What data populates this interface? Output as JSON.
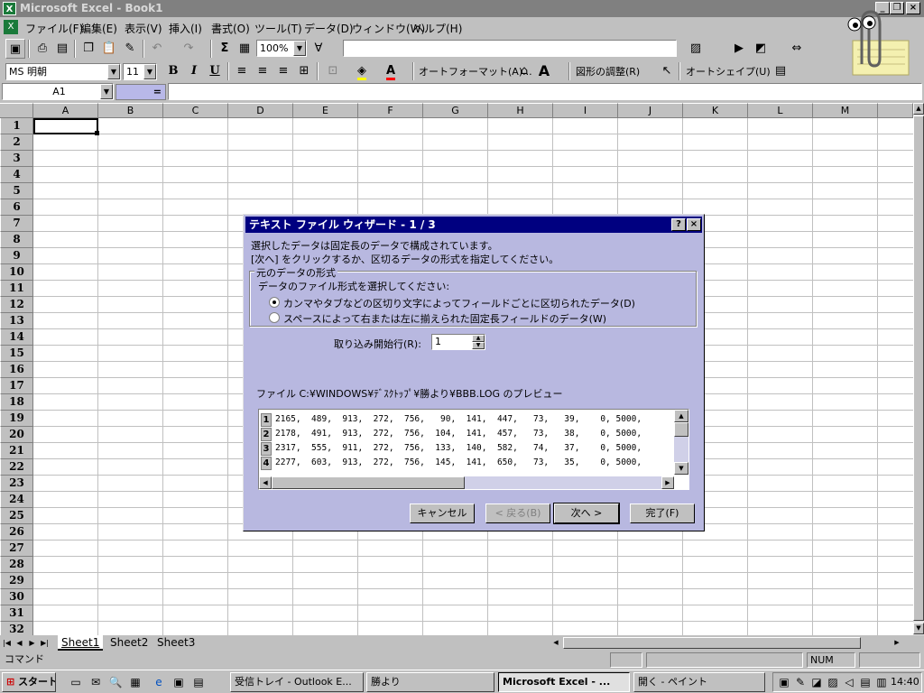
{
  "window": {
    "title": "Microsoft Excel - Book1",
    "app_icon": "excel-icon"
  },
  "menu": {
    "items": [
      "ファイル(F)",
      "編集(E)",
      "表示(V)",
      "挿入(I)",
      "書式(O)",
      "ツール(T)",
      "データ(D)",
      "ウィンドウ(W)",
      "ヘルプ(H)"
    ]
  },
  "toolbar1": {
    "zoom": "100%",
    "sum": "Σ"
  },
  "toolbar2": {
    "font_name": "MS 明朝",
    "font_size": "11",
    "bold": "B",
    "italic": "I",
    "underline": "U",
    "autoformat": "オートフォーマット(A)...",
    "picture_adjust": "図形の調整(R)",
    "autoshape": "オートシェイプ(U)",
    "font_color_letter": "A"
  },
  "formula": {
    "name_box": "A1",
    "equals": "="
  },
  "sheet": {
    "columns": [
      "A",
      "B",
      "C",
      "D",
      "E",
      "F",
      "G",
      "H",
      "I",
      "J",
      "K",
      "L",
      "M"
    ],
    "rows": [
      "1",
      "2",
      "3",
      "4",
      "5",
      "6",
      "7",
      "8",
      "9",
      "10",
      "11",
      "12",
      "13",
      "14",
      "15",
      "16",
      "17",
      "18",
      "19",
      "20",
      "21",
      "22",
      "23",
      "24",
      "25",
      "26",
      "27",
      "28",
      "29",
      "30",
      "31",
      "32"
    ],
    "tabs": [
      "Sheet1",
      "Sheet2",
      "Sheet3"
    ]
  },
  "status": {
    "mode": "コマンド",
    "num": "NUM"
  },
  "taskbar": {
    "start": "スタート",
    "buttons": [
      "受信トレイ - Outlook E...",
      "勝より",
      "Microsoft Excel - ...",
      "開く - ペイント"
    ],
    "clock": "14:40"
  },
  "dialog": {
    "title": "テキスト ファイル ウィザード - 1 / 3",
    "help": "?",
    "close": "×",
    "line1": "選択したデータは固定長のデータで構成されています。",
    "line2": "[次へ] をクリックするか、区切るデータの形式を指定してください。",
    "group_label": "元のデータの形式",
    "group_prompt": "データのファイル形式を選択してください:",
    "option1": "カンマやタブなどの区切り文字によってフィールドごとに区切られたデータ(D)",
    "option2": "スペースによって右または左に揃えられた固定長フィールドのデータ(W)",
    "start_row_label": "取り込み開始行(R):",
    "start_row_value": "1",
    "preview_label": "ファイル C:¥WINDOWS¥ﾃﾞｽｸﾄｯﾌﾟ¥勝より¥BBB.LOG のプレビュー",
    "preview_rows": [
      {
        "n": "1",
        "text": "2165,  489,  913,  272,  756,   90,  141,  447,   73,   39,    0, 5000,"
      },
      {
        "n": "2",
        "text": "2178,  491,  913,  272,  756,  104,  141,  457,   73,   38,    0, 5000,"
      },
      {
        "n": "3",
        "text": "2317,  555,  911,  272,  756,  133,  140,  582,   74,   37,    0, 5000,"
      },
      {
        "n": "4",
        "text": "2277,  603,  913,  272,  756,  145,  141,  650,   73,   35,    0, 5000,"
      }
    ],
    "buttons": {
      "cancel": "キャンセル",
      "back": "< 戻る(B)",
      "next": "次へ >",
      "finish": "完了(F)"
    }
  }
}
